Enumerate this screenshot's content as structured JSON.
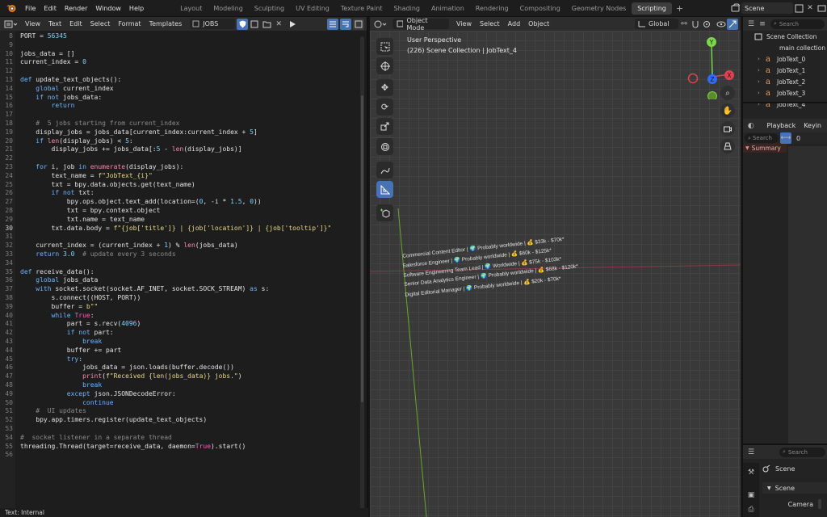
{
  "topbar": {
    "menus": [
      "File",
      "Edit",
      "Render",
      "Window",
      "Help"
    ],
    "workspaces": [
      "Layout",
      "Modeling",
      "Sculpting",
      "UV Editing",
      "Texture Paint",
      "Shading",
      "Animation",
      "Rendering",
      "Compositing",
      "Geometry Nodes",
      "Scripting"
    ],
    "active_workspace": "Scripting",
    "add_symbol": "+",
    "scene_name": "Scene"
  },
  "text_editor": {
    "menus": [
      "View",
      "Text",
      "Edit",
      "Select",
      "Format",
      "Templates"
    ],
    "file_name": "JOBS",
    "status": "Text: Internal",
    "current_line": "30",
    "lines": [
      {
        "n": "8",
        "code": "PORT = 56345"
      },
      {
        "n": "9",
        "code": ""
      },
      {
        "n": "10",
        "code": "jobs_data = []"
      },
      {
        "n": "11",
        "code": "current_index = 0"
      },
      {
        "n": "12",
        "code": ""
      },
      {
        "n": "13",
        "code": "def update_text_objects():"
      },
      {
        "n": "14",
        "code": "    global current_index"
      },
      {
        "n": "15",
        "code": "    if not jobs_data:"
      },
      {
        "n": "16",
        "code": "        return"
      },
      {
        "n": "17",
        "code": ""
      },
      {
        "n": "18",
        "code": "    #  5 jobs starting from current_index"
      },
      {
        "n": "19",
        "code": "    display_jobs = jobs_data[current_index:current_index + 5]"
      },
      {
        "n": "20",
        "code": "    if len(display_jobs) < 5:"
      },
      {
        "n": "21",
        "code": "        display_jobs += jobs_data[:5 - len(display_jobs)]"
      },
      {
        "n": "22",
        "code": ""
      },
      {
        "n": "23",
        "code": "    for i, job in enumerate(display_jobs):"
      },
      {
        "n": "24",
        "code": "        text_name = f\"JobText_{i}\""
      },
      {
        "n": "25",
        "code": "        txt = bpy.data.objects.get(text_name)"
      },
      {
        "n": "26",
        "code": "        if not txt:"
      },
      {
        "n": "27",
        "code": "            bpy.ops.object.text_add(location=(0, -i * 1.5, 0))"
      },
      {
        "n": "28",
        "code": "            txt = bpy.context.object"
      },
      {
        "n": "29",
        "code": "            txt.name = text_name"
      },
      {
        "n": "30",
        "code": "        txt.data.body = f\"{job['title']} | {job['location']} | {job['tooltip']}\""
      },
      {
        "n": "31",
        "code": ""
      },
      {
        "n": "32",
        "code": "    current_index = (current_index + 1) % len(jobs_data)"
      },
      {
        "n": "33",
        "code": "    return 3.0  # update every 3 seconds"
      },
      {
        "n": "34",
        "code": ""
      },
      {
        "n": "35",
        "code": "def receive_data():"
      },
      {
        "n": "36",
        "code": "    global jobs_data"
      },
      {
        "n": "37",
        "code": "    with socket.socket(socket.AF_INET, socket.SOCK_STREAM) as s:"
      },
      {
        "n": "38",
        "code": "        s.connect((HOST, PORT))"
      },
      {
        "n": "39",
        "code": "        buffer = b\"\""
      },
      {
        "n": "40",
        "code": "        while True:"
      },
      {
        "n": "41",
        "code": "            part = s.recv(4096)"
      },
      {
        "n": "42",
        "code": "            if not part:"
      },
      {
        "n": "43",
        "code": "                break"
      },
      {
        "n": "44",
        "code": "            buffer += part"
      },
      {
        "n": "45",
        "code": "            try:"
      },
      {
        "n": "46",
        "code": "                jobs_data = json.loads(buffer.decode())"
      },
      {
        "n": "47",
        "code": "                print(f\"Received {len(jobs_data)} jobs.\")"
      },
      {
        "n": "48",
        "code": "                break"
      },
      {
        "n": "49",
        "code": "            except json.JSONDecodeError:"
      },
      {
        "n": "50",
        "code": "                continue"
      },
      {
        "n": "51",
        "code": "    #  UI updates"
      },
      {
        "n": "52",
        "code": "    bpy.app.timers.register(update_text_objects)"
      },
      {
        "n": "53",
        "code": ""
      },
      {
        "n": "54",
        "code": "#  socket listener in a separate thread"
      },
      {
        "n": "55",
        "code": "threading.Thread(target=receive_data, daemon=True).start()"
      },
      {
        "n": "56",
        "code": ""
      }
    ]
  },
  "viewport": {
    "mode": "Object Mode",
    "menus": [
      "View",
      "Select",
      "Add",
      "Object"
    ],
    "transform_orientation": "Global",
    "view_label": "User Perspective",
    "collection_label": "(226) Scene Collection | JobText_4",
    "gizmo_axes": {
      "x": "X",
      "y": "Y",
      "z": "Z"
    },
    "job_texts": [
      "Commercial Content Editor | 🌍 Probably worldwide | 💰 $33k - $70k*",
      "Salesforce Engineer | 🌍 Probably worldwide | 💰 $60k - $125k*",
      "Software Engineering Team Lead | 🌍 Worldwide | 💰 $75k - $103k*",
      "Senior Data Analytics Engineer | 🌍 Probably worldwide | 💰 $68k - $120k*",
      "Digital Editorial Manager | 🌍 Probably worldwide | 💰 $20k - $70k*"
    ]
  },
  "outliner": {
    "search_placeholder": "Search",
    "root": "Scene Collection",
    "collection": "main collection",
    "items": [
      "JobText_0",
      "JobText_1",
      "JobText_2",
      "JobText_3",
      "JobText_4"
    ]
  },
  "timeline": {
    "playback_label": "Playback",
    "keying_label": "Keyin",
    "search_placeholder": "Search",
    "frame_value": "0",
    "summary_label": "Summary"
  },
  "properties": {
    "search_placeholder": "Search",
    "scene_tab": "Scene",
    "panel_title": "Scene",
    "camera_label": "Camera"
  }
}
